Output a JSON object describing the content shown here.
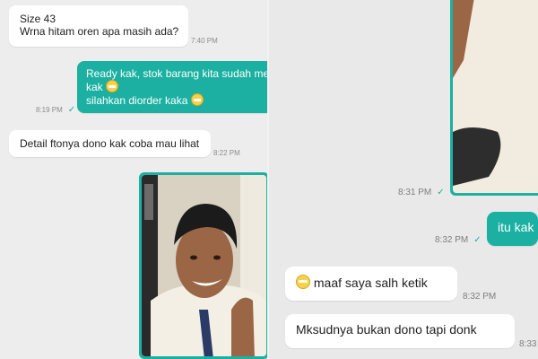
{
  "left_panel": {
    "messages": [
      {
        "kind": "incoming",
        "lines": [
          "Size 43",
          "Wrna hitam oren apa masih ada?"
        ],
        "time": "7:40 PM"
      },
      {
        "kind": "outgoing",
        "lines": [
          "Ready kak, stok barang kita sudah mer",
          "kak",
          "silahkan diorder kaka"
        ],
        "time": "8:19 PM"
      },
      {
        "kind": "incoming",
        "lines": [
          "Detail ftonya dono kak coba mau lihat"
        ],
        "time": "8:22 PM"
      }
    ]
  },
  "right_panel": {
    "photo_time": "8:31 PM",
    "out_text": "itu kak",
    "out_time": "8:32 PM",
    "msg1_text": "maaf saya salh ketik",
    "msg1_time": "8:32 PM",
    "msg2_text": "Mksudnya bukan dono tapi  donk",
    "msg2_time": "8:33"
  },
  "colors": {
    "accent": "#1bb0a1",
    "incoming_bubble": "#ffffff",
    "background": "#ededed"
  },
  "icons": {
    "read_check": "check-icon",
    "emoji": "grinning-emoji-icon"
  }
}
